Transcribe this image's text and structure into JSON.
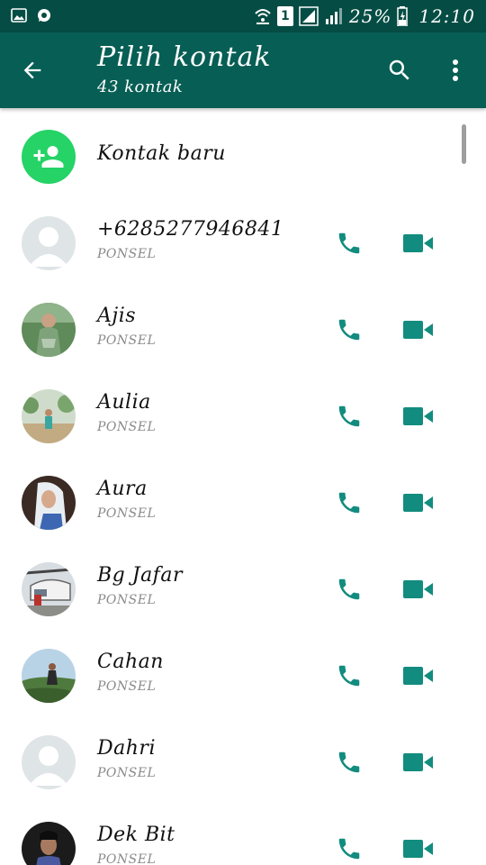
{
  "status_bar": {
    "battery": "25%",
    "time": "12:10",
    "sim_number": "1",
    "icons": [
      "gallery-icon",
      "whatsapp-icon",
      "wifi-icon",
      "sim-icon",
      "signal-icon",
      "signal-icon",
      "battery-icon"
    ]
  },
  "app_bar": {
    "title": "Pilih kontak",
    "subtitle": "43 kontak",
    "icons": [
      "back-arrow-icon",
      "search-icon",
      "more-vert-icon"
    ],
    "color": "#075e54"
  },
  "new_contact": {
    "label": "Kontak baru",
    "icon": "add-person-icon",
    "color": "#25d366"
  },
  "contacts": [
    {
      "name": "+6285277946841",
      "type": "PONSEL",
      "avatar": "default"
    },
    {
      "name": "Ajis",
      "type": "PONSEL",
      "avatar": "photo"
    },
    {
      "name": "Aulia",
      "type": "PONSEL",
      "avatar": "photo"
    },
    {
      "name": "Aura",
      "type": "PONSEL",
      "avatar": "photo"
    },
    {
      "name": "Bg Jafar",
      "type": "PONSEL",
      "avatar": "photo"
    },
    {
      "name": "Cahan",
      "type": "PONSEL",
      "avatar": "photo"
    },
    {
      "name": "Dahri",
      "type": "PONSEL",
      "avatar": "default"
    },
    {
      "name": "Dek Bit",
      "type": "PONSEL",
      "avatar": "photo"
    }
  ],
  "accent_color": "#128c7e"
}
